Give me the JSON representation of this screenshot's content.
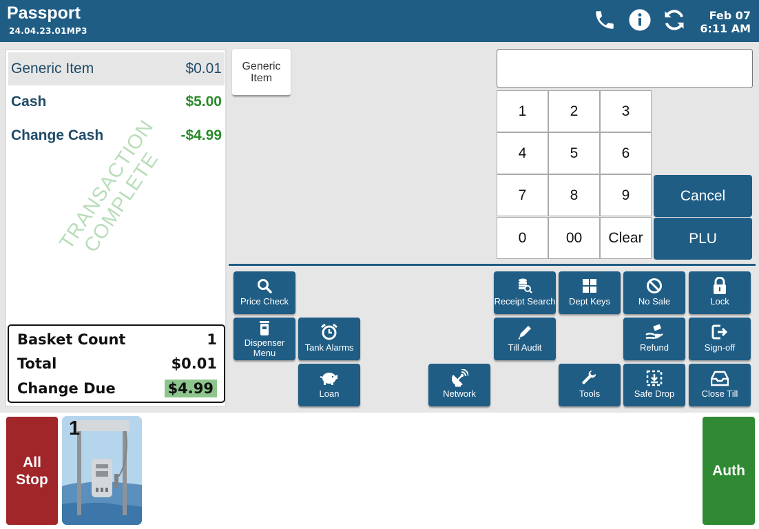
{
  "header": {
    "title": "Passport",
    "version": "24.04.23.01MP3",
    "date": "Feb 07",
    "time": "6:11 AM",
    "icons": [
      "phone-icon",
      "info-icon",
      "refresh-icon"
    ]
  },
  "receipt": {
    "item_name": "Generic Item",
    "item_price": "$0.01",
    "cash_label": "Cash",
    "cash_value": "$5.00",
    "change_label": "Change Cash",
    "change_value": "-$4.99",
    "stamp_line1": "TRANSACTION",
    "stamp_line2": "COMPLETE",
    "basket_count_label": "Basket Count",
    "basket_count_value": "1",
    "total_label": "Total",
    "total_value": "$0.01",
    "change_due_label": "Change Due",
    "change_due_value": "$4.99"
  },
  "quick_items": {
    "generic_item": "Generic Item"
  },
  "keypad": {
    "entry_value": "",
    "keys": [
      "1",
      "2",
      "3",
      "4",
      "5",
      "6",
      "7",
      "8",
      "9",
      "0",
      "00",
      "Clear"
    ],
    "cancel": "Cancel",
    "plu": "PLU"
  },
  "functions": {
    "price_check": "Price Check",
    "receipt_search": "Receipt Search",
    "dept_keys": "Dept Keys",
    "no_sale": "No Sale",
    "lock": "Lock",
    "dispenser_menu": "Dispenser Menu",
    "tank_alarms": "Tank Alarms",
    "till_audit": "Till Audit",
    "refund": "Refund",
    "sign_off": "Sign-off",
    "loan": "Loan",
    "network": "Network",
    "tools": "Tools",
    "safe_drop": "Safe Drop",
    "close_till": "Close Till"
  },
  "forecourt": {
    "all_stop": "All Stop",
    "pump_number": "1",
    "auth": "Auth"
  },
  "colors": {
    "brand_blue": "#1f5d85",
    "all_stop_red": "#a0262a",
    "auth_green": "#2f8a33",
    "positive_green": "#2a8a2a",
    "change_due_bg": "#8dc58d"
  }
}
